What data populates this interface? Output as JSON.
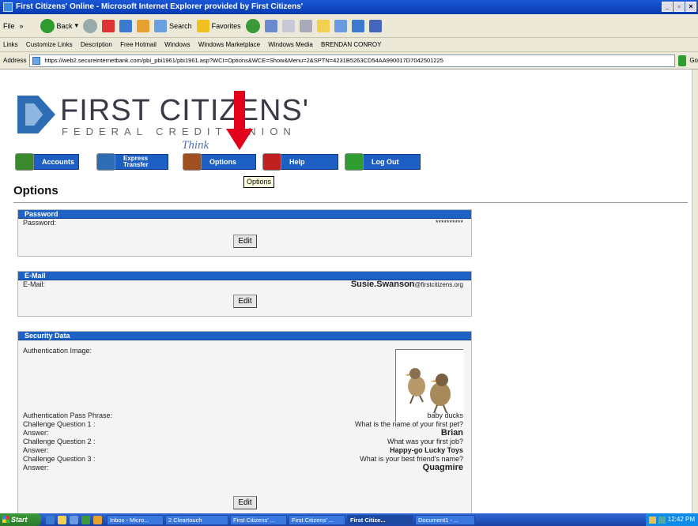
{
  "window": {
    "title": "First Citizens' Online - Microsoft Internet Explorer provided by First Citizens'"
  },
  "toolbar": {
    "file_menu": "File",
    "back": "Back",
    "search": "Search",
    "favorites": "Favorites"
  },
  "links_bar": {
    "items": [
      "Links",
      "Customize Links",
      "Description",
      "Free Hotmail",
      "Windows",
      "Windows Marketplace",
      "Windows Media",
      "BRENDAN CONROY"
    ]
  },
  "address": {
    "label": "Address",
    "url": "https://web2.secureinternetbank.com/pbi_pbi1961/pbi1961.asp?WCI=Options&WCE=Show&Menu=2&SPTN=4231B5263CD54AA990017D7042501225",
    "go": "Go"
  },
  "brand": {
    "name": "FIRST CITIZENS'",
    "sub": "FEDERAL CREDIT UNION",
    "tagline": "Think"
  },
  "nav": {
    "items": [
      {
        "label": "Accounts",
        "color": "#3a8a2e"
      },
      {
        "label": "Express Transfer",
        "color": "#2e6db4"
      },
      {
        "label": "Options",
        "color": "#a05020"
      },
      {
        "label": "Help",
        "color": "#c02020"
      },
      {
        "label": "Log Out",
        "color": "#2e9c2e"
      }
    ],
    "tooltip": "Options"
  },
  "page": {
    "title": "Options"
  },
  "password_panel": {
    "header": "Password",
    "label": "Password:",
    "value": "**********",
    "edit": "Edit"
  },
  "email_panel": {
    "header": "E-Mail",
    "label": "E-Mail:",
    "value_user": "Susie.Swanson",
    "value_domain": "@firstcitizens.org",
    "edit": "Edit"
  },
  "security_panel": {
    "header": "Security Data",
    "auth_image_label": "Authentication Image:",
    "auth_image_icon": "ducklings-image",
    "rows": [
      {
        "label": "Authentication Pass Phrase:",
        "value": "baby ducks",
        "bold": false
      },
      {
        "label": "Challenge Question 1 :",
        "value": "What is the name of your first pet?",
        "bold": false
      },
      {
        "label": "Answer:",
        "value": "Brian",
        "bold": true
      },
      {
        "label": "Challenge Question 2 :",
        "value": "What was your first job?",
        "bold": false
      },
      {
        "label": "Answer:",
        "value": "Happy-go Lucky Toys",
        "bold": true
      },
      {
        "label": "Challenge Question 3 :",
        "value": "What is your best friend's name?",
        "bold": false
      },
      {
        "label": "Answer:",
        "value": "Quagmire",
        "bold": true
      }
    ],
    "edit": "Edit"
  },
  "taskbar": {
    "start": "Start",
    "tasks": [
      "Inbox - Micro...",
      "2 Cleartouch",
      "First Citizens' ...",
      "First Citizens' ...",
      "First Citize...",
      "Document1 - ..."
    ],
    "clock": "12:42 PM"
  },
  "colors": {
    "accent": "#1e62c6",
    "arrow": "#e3001b"
  }
}
